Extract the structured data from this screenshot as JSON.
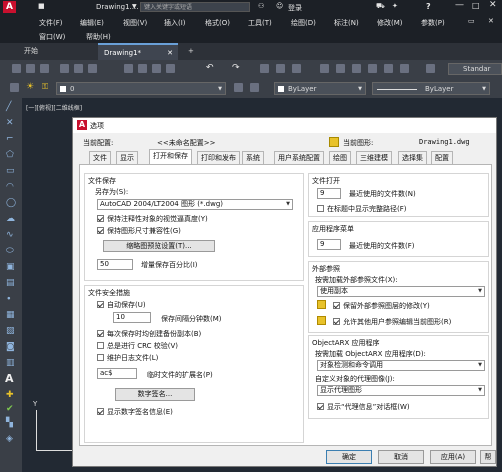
{
  "window": {
    "doc_tab": "Drawing1....",
    "search_placeholder": "键入关键字或短语",
    "login": "登录",
    "help": "?"
  },
  "menu_row1": [
    "文件(F)",
    "编辑(E)",
    "视图(V)",
    "插入(I)",
    "格式(O)",
    "工具(T)",
    "绘图(D)",
    "标注(N)",
    "修改(M)",
    "参数(P)"
  ],
  "menu_row2": [
    "窗口(W)",
    "帮助(H)"
  ],
  "file_tabs": {
    "start": "开始",
    "drawing": "Drawing1*",
    "plus": "+"
  },
  "toolbar": {
    "style": "Standar",
    "layer_value": "0",
    "bylayer1": "ByLayer",
    "bylayer2": "ByLayer"
  },
  "viewport_label": "[一][俯视][二维线框]",
  "dialog": {
    "title": "选项",
    "current_profile_label": "当前配置:",
    "current_profile_value": "<<未命名配置>>",
    "current_drawing_label": "当前图形:",
    "current_drawing_value": "Drawing1.dwg",
    "tabs": [
      "文件",
      "显示",
      "打开和保存",
      "打印和发布",
      "系统",
      "用户系统配置",
      "绘图",
      "三维建模",
      "选择集",
      "配置"
    ],
    "active_tab_index": 2,
    "file_save": {
      "title": "文件保存",
      "save_as_label": "另存为(S):",
      "save_as_value": "AutoCAD 2004/LT2004 图形 (*.dwg)",
      "cb1": "保持注释性对象的视觉逼真度(Y)",
      "cb1_checked": true,
      "cb2": "保持图形尺寸兼容性(G)",
      "cb2_checked": true,
      "thumb_button": "缩略图预览设置(T)...",
      "incr_value": "50",
      "incr_label": "增量保存百分比(I)"
    },
    "file_safety": {
      "title": "文件安全措施",
      "autosave": "自动保存(U)",
      "autosave_checked": true,
      "minutes_value": "10",
      "minutes_label": "保存间隔分钟数(M)",
      "backup": "每次保存时均创建备份副本(B)",
      "backup_checked": true,
      "crc": "总是进行 CRC 校验(V)",
      "crc_checked": false,
      "log": "维护日志文件(L)",
      "log_checked": false,
      "temp_ext_value": "ac$",
      "temp_ext_label": "临时文件的扩展名(P)",
      "sign_button": "数字签名...",
      "show_sign": "显示数字签名信息(E)",
      "show_sign_checked": true
    },
    "file_open": {
      "title": "文件打开",
      "recent_value": "9",
      "recent_label": "最近使用的文件数(N)",
      "fullpath": "在标题中显示完整路径(F)",
      "fullpath_checked": false
    },
    "app_menu": {
      "title": "应用程序菜单",
      "recent_value": "9",
      "recent_label": "最近使用的文件数(F)"
    },
    "xref": {
      "title": "外部参照",
      "demand_label": "按需加载外部参照文件(X):",
      "demand_value": "使用副本",
      "keep_changes": "保留外部参照图层的修改(Y)",
      "keep_checked": true,
      "allow_edit": "允许其他用户参照编辑当前图形(R)",
      "allow_checked": true
    },
    "arx": {
      "title": "ObjectARX 应用程序",
      "demand_label": "按需加载 ObjectARX 应用程序(D):",
      "demand_value": "对象检测和命令调用",
      "proxy_label": "自定义对象的代理图像(J):",
      "proxy_value": "显示代理图形",
      "proxy_info": "显示“代理信息”对话框(W)",
      "proxy_info_checked": true
    },
    "buttons": {
      "ok": "确定",
      "cancel": "取消",
      "apply": "应用(A)",
      "help": "帮"
    }
  }
}
